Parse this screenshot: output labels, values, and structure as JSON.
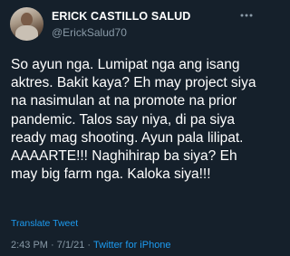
{
  "user": {
    "display_name": "ERICK CASTILLO SALUD",
    "handle": "@ErickSalud70"
  },
  "tweet": {
    "lines": [
      "So ayun nga. Lumipat nga ang isang",
      "aktres. Bakit kaya? Eh may project siya",
      "na nasimulan at na promote na prior",
      "pandemic. Talos say niya, di pa siya",
      "ready mag shooting. Ayun pala lilipat.",
      "AAAARTE!!! Naghihirap ba siya? Eh",
      "may big farm nga. Kaloka siya!!!"
    ],
    "translate_label": "Translate Tweet",
    "time": "2:43 PM",
    "date": "7/1/21",
    "separator": "·",
    "source": "Twitter for iPhone"
  },
  "icons": {
    "more": "more-options-icon",
    "avatar": "avatar"
  },
  "colors": {
    "background": "#15202b",
    "text": "#ffffff",
    "secondary": "#8899a6",
    "link": "#1d9bf0"
  }
}
